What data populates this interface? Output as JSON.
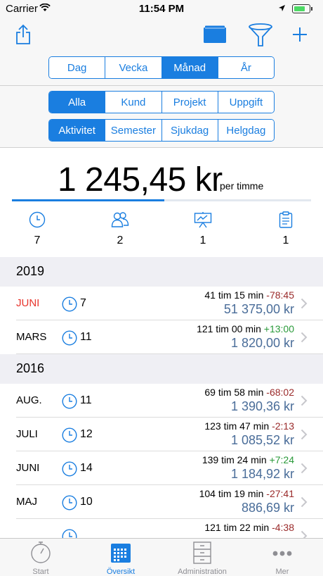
{
  "status_bar": {
    "carrier": "Carrier",
    "time": "11:54 PM"
  },
  "toolbar": {
    "share_icon": "share-icon",
    "folder_icon": "folder-icon",
    "filter_icon": "filter-icon",
    "add_icon": "plus-icon"
  },
  "period_segments": [
    "Dag",
    "Vecka",
    "Månad",
    "År"
  ],
  "period_active": "Månad",
  "scope_segments": [
    "Alla",
    "Kund",
    "Projekt",
    "Uppgift"
  ],
  "scope_active": "Alla",
  "type_segments": [
    "Aktivitet",
    "Semester",
    "Sjukdag",
    "Helgdag"
  ],
  "type_active": "Aktivitet",
  "summary": {
    "amount": "1 245,45 kr",
    "unit": "per timme",
    "progress_fraction": 0.51,
    "stats": [
      {
        "icon": "clock-icon",
        "value": "7"
      },
      {
        "icon": "people-icon",
        "value": "2"
      },
      {
        "icon": "presentation-icon",
        "value": "1"
      },
      {
        "icon": "clipboard-icon",
        "value": "1"
      }
    ]
  },
  "sections": [
    {
      "year": "2019",
      "rows": [
        {
          "month": "JUNI",
          "highlight": true,
          "count": "7",
          "time": "41 tim 15 min",
          "diff": "-78:45",
          "diff_sign": "neg",
          "money": "51 375,00 kr"
        },
        {
          "month": "MARS",
          "highlight": false,
          "count": "11",
          "time": "121 tim 00 min",
          "diff": "+13:00",
          "diff_sign": "pos",
          "money": "1 820,00 kr"
        }
      ]
    },
    {
      "year": "2016",
      "rows": [
        {
          "month": "AUG.",
          "highlight": false,
          "count": "11",
          "time": "69 tim 58 min",
          "diff": "-68:02",
          "diff_sign": "neg",
          "money": "1 390,36 kr"
        },
        {
          "month": "JULI",
          "highlight": false,
          "count": "12",
          "time": "123 tim 47 min",
          "diff": "-2:13",
          "diff_sign": "neg",
          "money": "1 085,52 kr"
        },
        {
          "month": "JUNI",
          "highlight": false,
          "count": "14",
          "time": "139 tim 24 min",
          "diff": "+7:24",
          "diff_sign": "pos",
          "money": "1 184,92 kr"
        },
        {
          "month": "MAJ",
          "highlight": false,
          "count": "10",
          "time": "104 tim 19 min",
          "diff": "-27:41",
          "diff_sign": "neg",
          "money": "886,69 kr"
        },
        {
          "month": "",
          "highlight": false,
          "count": "",
          "time": "121 tim 22 min",
          "diff": "-4:38",
          "diff_sign": "neg",
          "money": ""
        }
      ]
    }
  ],
  "tabbar": [
    {
      "label": "Start",
      "icon": "compass-icon",
      "active": false
    },
    {
      "label": "Översikt",
      "icon": "calendar-icon",
      "active": true
    },
    {
      "label": "Administration",
      "icon": "cabinet-icon",
      "active": false
    },
    {
      "label": "Mer",
      "icon": "more-icon",
      "active": false
    }
  ],
  "colors": {
    "accent": "#1a7ee0",
    "money": "#4a6d99",
    "negative": "#9a2a2a",
    "positive": "#2a9a3a",
    "highlight_month": "#e8352d"
  }
}
